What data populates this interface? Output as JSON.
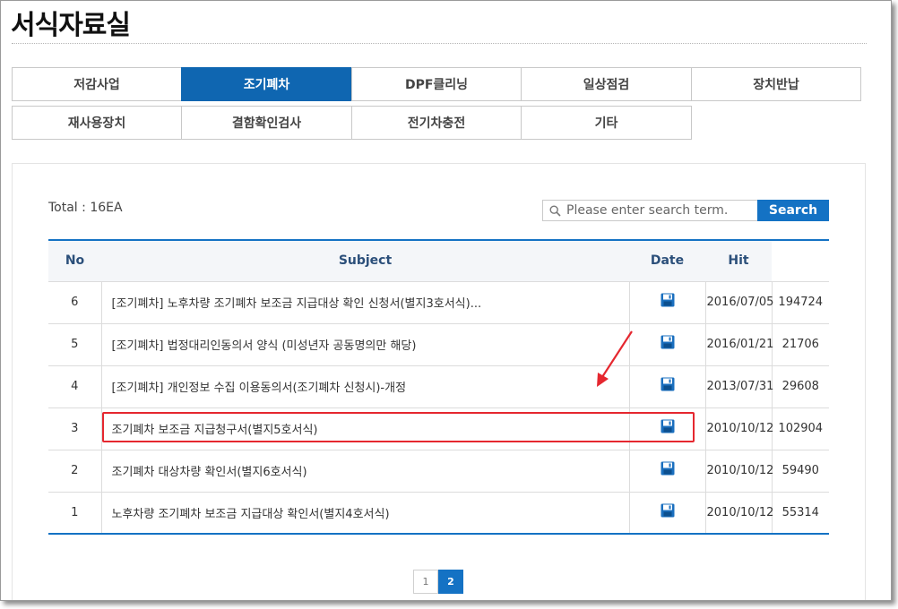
{
  "page": {
    "title": "서식자료실"
  },
  "tabs": [
    {
      "label": "저감사업",
      "active": false
    },
    {
      "label": "조기폐차",
      "active": true
    },
    {
      "label": "DPF클리닝",
      "active": false
    },
    {
      "label": "일상점검",
      "active": false
    },
    {
      "label": "장치반납",
      "active": false
    },
    {
      "label": "재사용장치",
      "active": false
    },
    {
      "label": "결함확인검사",
      "active": false
    },
    {
      "label": "전기차충전",
      "active": false
    },
    {
      "label": "기타",
      "active": false
    }
  ],
  "board": {
    "total": "Total : 16EA",
    "search": {
      "placeholder": "Please enter search term.",
      "button": "Search"
    },
    "columns": {
      "no": "No",
      "subject": "Subject",
      "date": "Date",
      "hit": "Hit"
    },
    "rows": [
      {
        "no": "6",
        "subject": "[조기폐차] 노후차량 조기폐차 보조금 지급대상 확인 신청서(별지3호서식)...",
        "date": "2016/07/05",
        "hit": "194724"
      },
      {
        "no": "5",
        "subject": "[조기폐차] 법정대리인동의서 양식 (미성년자 공동명의만 해당)",
        "date": "2016/01/21",
        "hit": "21706"
      },
      {
        "no": "4",
        "subject": "[조기폐차] 개인정보 수집 이용동의서(조기폐차 신청시)-개정",
        "date": "2013/07/31",
        "hit": "29608"
      },
      {
        "no": "3",
        "subject": "조기폐차 보조금 지급청구서(별지5호서식)",
        "date": "2010/10/12",
        "hit": "102904"
      },
      {
        "no": "2",
        "subject": "조기폐차 대상차량 확인서(별지6호서식)",
        "date": "2010/10/12",
        "hit": "59490"
      },
      {
        "no": "1",
        "subject": "노후차량 조기폐차 보조금 지급대상 확인서(별지4호서식)",
        "date": "2010/10/12",
        "hit": "55314"
      }
    ]
  },
  "pagination": {
    "pages": [
      "1",
      "2"
    ],
    "current": "2"
  },
  "colors": {
    "accent": "#0f66b1",
    "button": "#1472c4",
    "highlight": "#e5272f"
  },
  "icons": {
    "search": "search-icon",
    "download": "floppy-save-icon"
  }
}
